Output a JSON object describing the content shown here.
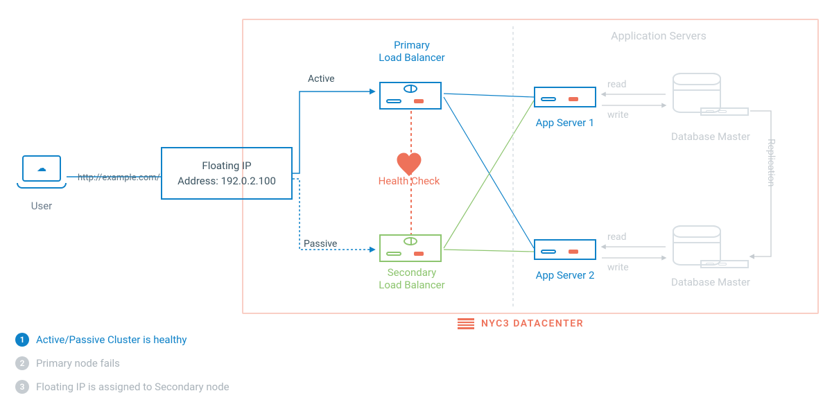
{
  "user_label": "User",
  "url": "http://example.com/",
  "floating_ip": {
    "line1": "Floating IP",
    "line2": "Address: 192.0.2.100"
  },
  "labels": {
    "active": "Active",
    "passive": "Passive",
    "primary_lb_l1": "Primary",
    "primary_lb_l2": "Load Balancer",
    "secondary_lb_l1": "Secondary",
    "secondary_lb_l2": "Load Balancer",
    "health_check": "Health Check",
    "app_server1": "App Server 1",
    "app_server2": "App Server 2",
    "app_servers_header": "Application Servers",
    "db_master": "Database Master",
    "read": "read",
    "write": "write",
    "replication": "Replication"
  },
  "datacenter": "NYC3 DATACENTER",
  "steps": [
    {
      "n": "1",
      "text": "Active/Passive Cluster is healthy",
      "active": true
    },
    {
      "n": "2",
      "text": "Primary node fails",
      "active": false
    },
    {
      "n": "3",
      "text": "Floating IP is assigned to Secondary node",
      "active": false
    }
  ],
  "colors": {
    "blue": "#0f82c8",
    "green": "#8dc56f",
    "orange": "#ee725a",
    "grey": "#c6ccd1"
  }
}
